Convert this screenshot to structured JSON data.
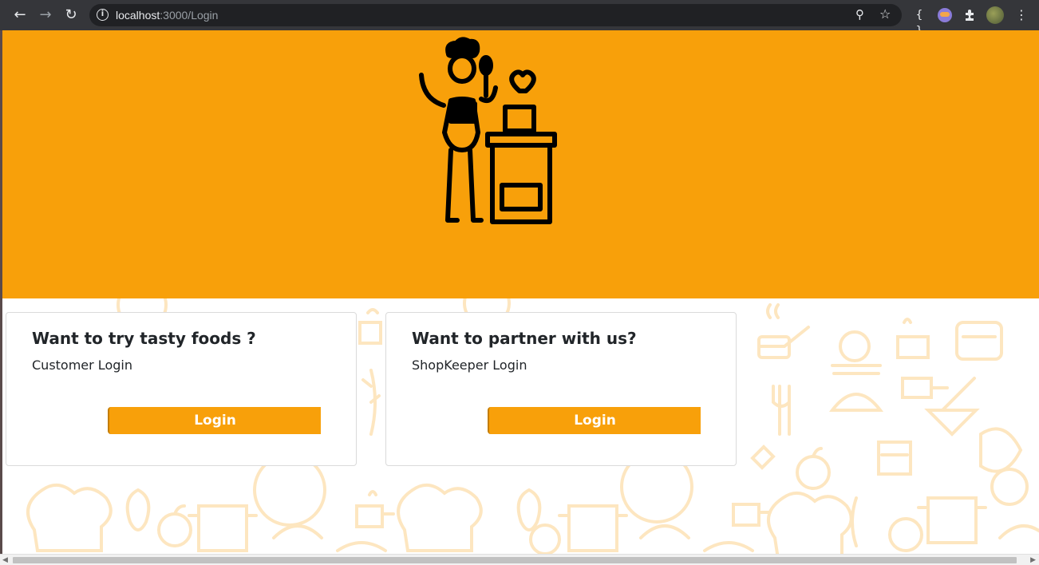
{
  "browser": {
    "url_host": "localhost",
    "url_path": ":3000/Login",
    "icons": {
      "back": "back-arrow-icon",
      "forward": "forward-arrow-icon",
      "reload": "reload-icon",
      "info": "info-icon",
      "zoom": "zoom-icon",
      "bookmark": "star-icon",
      "extension_braces": "braces-icon",
      "extension_owl": "owl-extension-icon",
      "extensions": "puzzle-icon",
      "profile": "profile-avatar",
      "menu": "kebab-menu-icon"
    }
  },
  "theme": {
    "accent": "#f8a00a",
    "pattern": "#fde8c4",
    "text": "#212529"
  },
  "hero": {
    "illustration": "chef-cooking-icon"
  },
  "cards": [
    {
      "title": "Want to try tasty foods ?",
      "subtitle": "Customer Login",
      "button": "Login"
    },
    {
      "title": "Want to partner with us?",
      "subtitle": "ShopKeeper Login",
      "button": "Login"
    }
  ]
}
